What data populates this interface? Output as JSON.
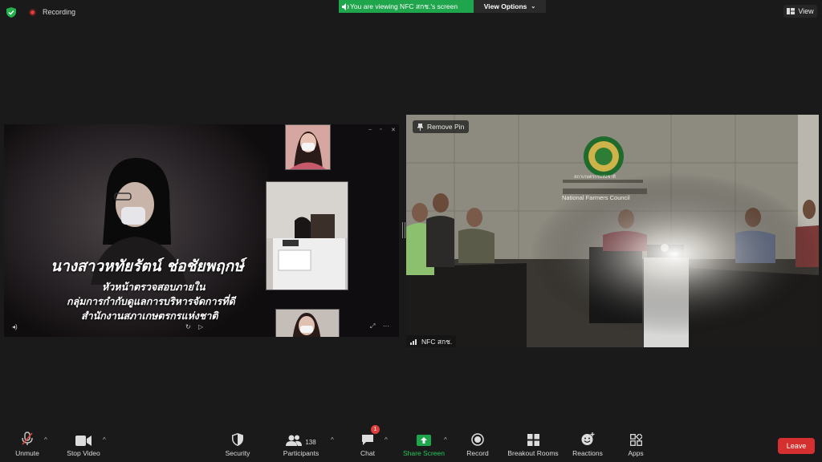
{
  "top": {
    "recording_label": "Recording",
    "banner_text": "You are viewing NFC สกช.'s screen",
    "view_options_label": "View Options",
    "view_label": "View"
  },
  "shared_screen": {
    "name": "นางสาวหทัยรัตน์ ช่อชัยพฤกษ์",
    "title_line1": "หัวหน้าตรวจสอบภายใน",
    "title_line2": "กลุ่มการกำกับดูแลการบริหารจัดการที่ดี",
    "title_line3": "สำนักงานสภาเกษตรกรแห่งชาติ"
  },
  "camera": {
    "remove_pin_label": "Remove Pin",
    "participant_label": "NFC สกช.",
    "wall_sign_th": "สภาเกษตรกรแห่งชาติ",
    "wall_sign_en": "National Farmers Council"
  },
  "toolbar": {
    "unmute": "Unmute",
    "stop_video": "Stop Video",
    "security": "Security",
    "participants": "Participants",
    "participants_count": "138",
    "chat": "Chat",
    "chat_badge": "1",
    "share_screen": "Share Screen",
    "record": "Record",
    "breakout_rooms": "Breakout Rooms",
    "reactions": "Reactions",
    "apps": "Apps",
    "leave": "Leave"
  },
  "colors": {
    "banner_green": "#1fa54c",
    "leave_red": "#d3302f",
    "share_green": "#1fa54c"
  }
}
